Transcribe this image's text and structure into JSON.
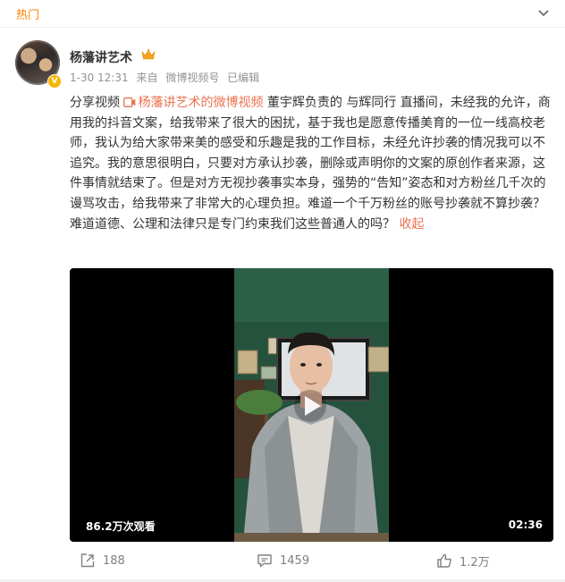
{
  "feed_header": {
    "label": "热门"
  },
  "post": {
    "author": "杨藩讲艺术",
    "meta": {
      "time": "1-30 12:31",
      "source_prefix": "来自",
      "source": "微博视频号",
      "edited": "已编辑"
    },
    "text": {
      "prefix": "分享视频 ",
      "video_link": "杨藩讲艺术的微博视频",
      "body": " 董宇辉负责的 与辉同行 直播间，未经我的允许，商用我的抖音文案，给我带来了很大的困扰，基于我也是愿意传播美育的一位一线高校老师，我认为给大家带来美的感受和乐趣是我的工作目标，未经允许抄袭的情况我可以不追究。我的意思很明白，只要对方承认抄袭，删除或声明你的文案的原创作者来源，这件事情就结束了。但是对方无视抄袭事实本身，强势的“告知”姿态和对方粉丝几千次的谩骂攻击，给我带来了非常大的心理负担。难道一个千万粉丝的账号抄袭就不算抄袭？难道道德、公理和法律只是专门约束我们这些普通人的吗？",
      "collapse": "收起"
    },
    "video": {
      "views": "86.2万次观看",
      "duration": "02:36"
    },
    "actions": {
      "share_count": "188",
      "comment_count": "1459",
      "like_count": "1.2万"
    }
  },
  "colors": {
    "accent": "#ff8200",
    "link": "#eb7350",
    "muted": "#939393"
  }
}
